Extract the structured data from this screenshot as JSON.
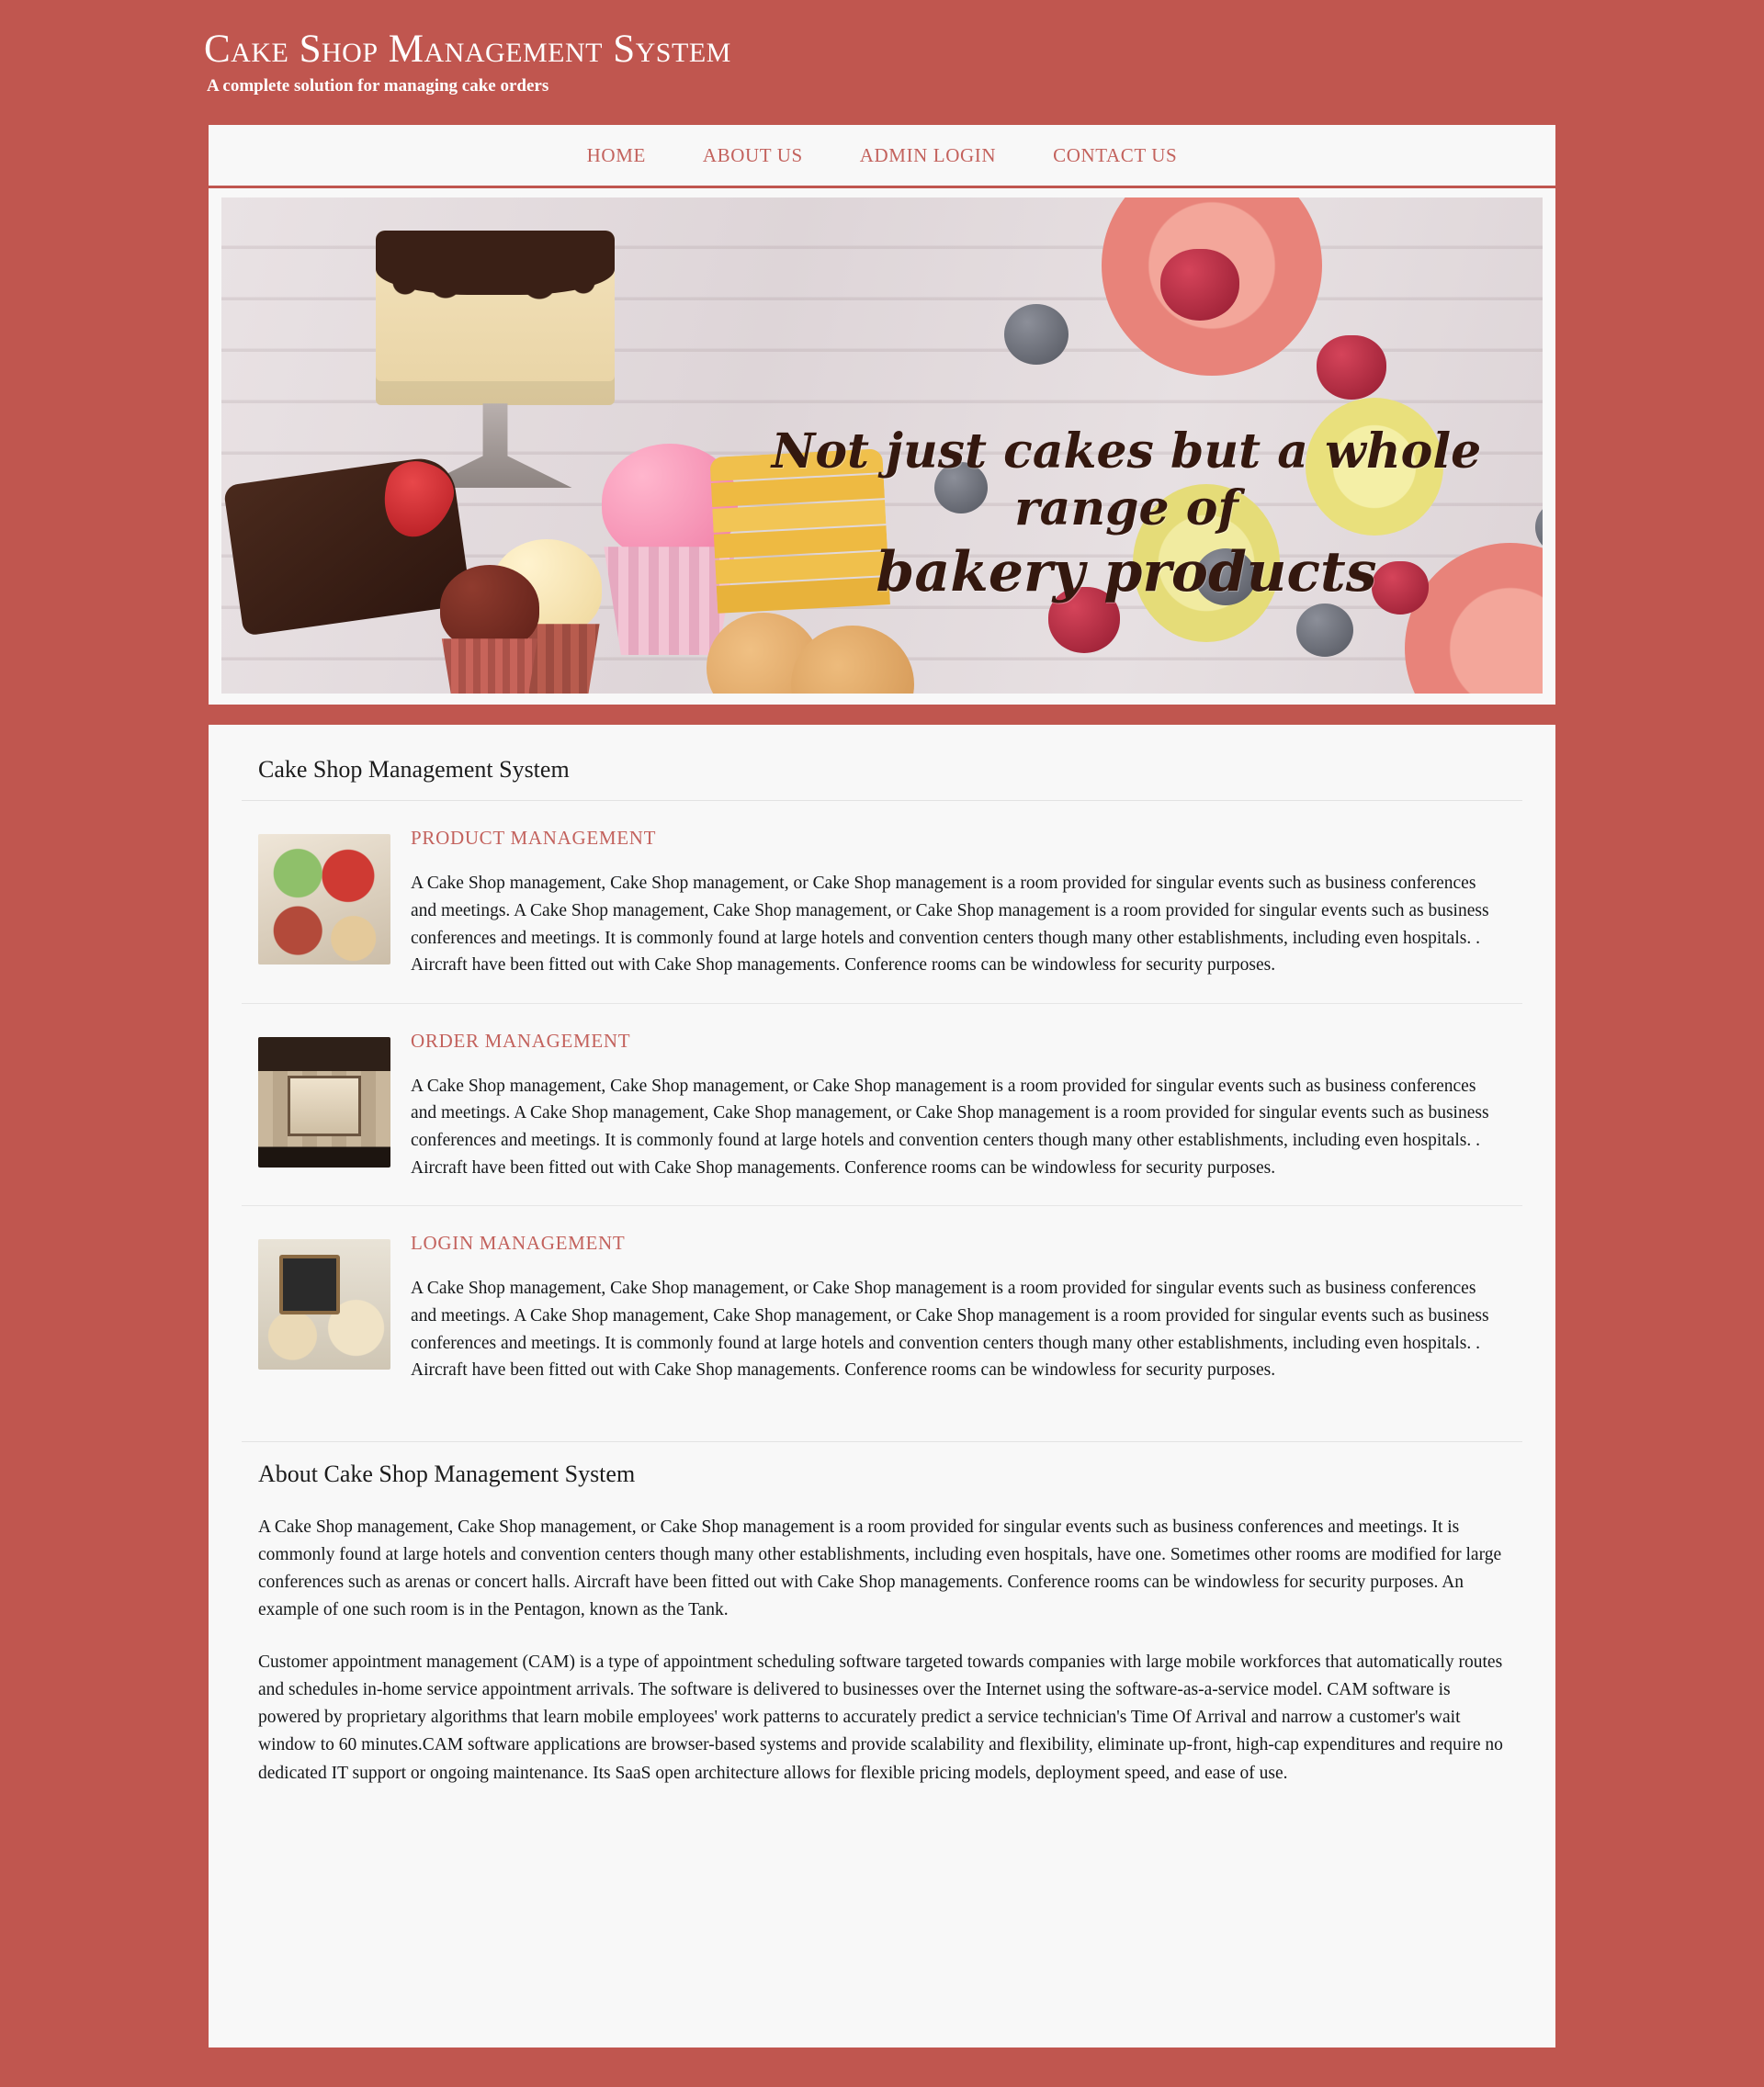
{
  "header": {
    "title": "Cake Shop Management System",
    "subtitle": "A complete solution for managing cake orders"
  },
  "nav": {
    "items": [
      {
        "label": "HOME"
      },
      {
        "label": "ABOUT US"
      },
      {
        "label": "ADMIN LOGIN"
      },
      {
        "label": "CONTACT US"
      }
    ]
  },
  "banner": {
    "line1": "Not just cakes but a whole range of",
    "line2": "bakery products"
  },
  "main": {
    "section_title": "Cake Shop Management System",
    "features": [
      {
        "heading": "PRODUCT MANAGEMENT",
        "thumb": "cupcakes-photo",
        "body": "A Cake Shop management, Cake Shop management, or Cake Shop management is a room provided for singular events such as business conferences and meetings. A Cake Shop management, Cake Shop management, or Cake Shop management is a room provided for singular events such as business conferences and meetings. It is commonly found at large hotels and convention centers though many other establishments, including even hospitals. . Aircraft have been fitted out with Cake Shop managements. Conference rooms can be windowless for security purposes."
      },
      {
        "heading": "ORDER MANAGEMENT",
        "thumb": "shopfront-photo",
        "body": "A Cake Shop management, Cake Shop management, or Cake Shop management is a room provided for singular events such as business conferences and meetings. A Cake Shop management, Cake Shop management, or Cake Shop management is a room provided for singular events such as business conferences and meetings. It is commonly found at large hotels and convention centers though many other establishments, including even hospitals. . Aircraft have been fitted out with Cake Shop managements. Conference rooms can be windowless for security purposes."
      },
      {
        "heading": "LOGIN MANAGEMENT",
        "thumb": "dessert-table-photo",
        "body": "A Cake Shop management, Cake Shop management, or Cake Shop management is a room provided for singular events such as business conferences and meetings. A Cake Shop management, Cake Shop management, or Cake Shop management is a room provided for singular events such as business conferences and meetings. It is commonly found at large hotels and convention centers though many other establishments, including even hospitals. . Aircraft have been fitted out with Cake Shop managements. Conference rooms can be windowless for security purposes."
      }
    ],
    "about_title": "About Cake Shop Management System",
    "about_paragraphs": [
      "A Cake Shop management, Cake Shop management, or Cake Shop management is a room provided for singular events such as business conferences and meetings. It is commonly found at large hotels and convention centers though many other establishments, including even hospitals, have one. Sometimes other rooms are modified for large conferences such as arenas or concert halls. Aircraft have been fitted out with Cake Shop managements. Conference rooms can be windowless for security purposes. An example of one such room is in the Pentagon, known as the Tank.",
      "Customer appointment management (CAM) is a type of appointment scheduling software targeted towards companies with large mobile workforces that automatically routes and schedules in-home service appointment arrivals. The software is delivered to businesses over the Internet using the software-as-a-service model. CAM software is powered by proprietary algorithms that learn mobile employees' work patterns to accurately predict a service technician's Time Of Arrival and narrow a customer's wait window to 60 minutes.CAM software applications are browser-based systems and provide scalability and flexibility, eliminate up-front, high-cap expenditures and require no dedicated IT support or ongoing maintenance. Its SaaS open architecture allows for flexible pricing models, deployment speed, and ease of use."
    ]
  },
  "colors": {
    "brand": "#c0564f",
    "accent": "#c3625d",
    "card": "#f8f8f8",
    "text": "#16181a"
  }
}
